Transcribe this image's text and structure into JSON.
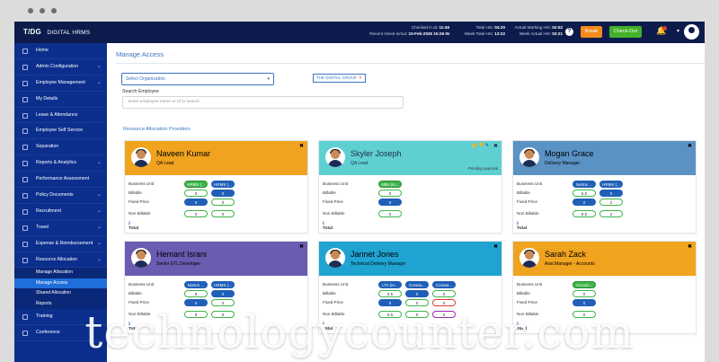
{
  "header": {
    "logo_mark": "T/DG",
    "logo_sub": "DIGITAL HRMS",
    "checked_in_label": "Checked in at:",
    "checked_in_value": "11:46",
    "recent_checkin_label": "Recent check-in/out:",
    "recent_checkin_value": "10-Feb-2025 15:26 IN",
    "total_hrs_label": "Total Hrs:",
    "total_hrs_value": "04:20",
    "week_total_label": "Week Total Hrs:",
    "week_total_value": "13:22",
    "actual_working_label": "Actual Working Hrs:",
    "actual_working_value": "02:52",
    "week_actual_label": "Week Actual Hrs:",
    "week_actual_value": "03:21",
    "help_icon": "?",
    "break_label": "Break",
    "checkout_label": "Check-Out",
    "bell_icon": "bell-icon"
  },
  "sidebar": {
    "items": [
      {
        "label": "Home",
        "caret": ""
      },
      {
        "label": "Admin Configuration",
        "caret": "⌄"
      },
      {
        "label": "Employee Management",
        "caret": "⌄"
      },
      {
        "label": "My Details",
        "caret": ""
      },
      {
        "label": "Leave & Attendance",
        "caret": ""
      },
      {
        "label": "Employee Self Service",
        "caret": ""
      },
      {
        "label": "Separation",
        "caret": ""
      },
      {
        "label": "Reports & Analytics",
        "caret": "⌄"
      },
      {
        "label": "Performance Assessment",
        "caret": ""
      },
      {
        "label": "Policy Documents",
        "caret": "⌄"
      },
      {
        "label": "Recruitment",
        "caret": "⌄"
      },
      {
        "label": "Travel",
        "caret": "⌄"
      },
      {
        "label": "Expense & Reimbursement",
        "caret": "⌄"
      },
      {
        "label": "Resource Allocation",
        "caret": "⌄"
      }
    ],
    "subitems": [
      "Manage Allocation",
      "Manage Access",
      "Shared Allocation",
      "Reports"
    ],
    "after_items": [
      {
        "label": "Training",
        "caret": ""
      },
      {
        "label": "Conference",
        "caret": ""
      }
    ]
  },
  "main": {
    "title": "Manage Access",
    "select_org": "Select Organization",
    "org_tag": "THE DIGITAL GROUP",
    "search_label": "Search Employee",
    "search_placeholder": "Enter employee name or Id to search",
    "section_title": "Resource Allocation Providers"
  },
  "row_labels": {
    "bu": "Business Unit",
    "billable": "Billable",
    "fixed": "Fixed Price",
    "nonbill": "Non Billable",
    "total": "Total",
    "info": "ℹ"
  },
  "cards": [
    {
      "name": "Naveen Kumar",
      "role": "QA Lead",
      "color": "#f0a31e",
      "bu": [
        "HRMS (...",
        "HRMS (..."
      ],
      "billable": [
        "0",
        "0"
      ],
      "fixed": [
        "0",
        "0"
      ],
      "nonbill": [
        "0",
        "0"
      ]
    },
    {
      "name": "Skyler Joseph",
      "role": "QA Lead",
      "color": "#5fd0d2",
      "pending": "Pending Approval",
      "bu": [
        "NBA (In..."
      ],
      "billable": [
        "0"
      ],
      "fixed": [
        "0"
      ],
      "nonbill": [
        "0"
      ]
    },
    {
      "name": "Mogan Grace",
      "role": "Delivery Manager",
      "color": "#5a92c4",
      "bu": [
        "Norton ...",
        "HRMS (..."
      ],
      "billable": [
        "6.5",
        "0"
      ],
      "fixed": [
        "2",
        "2"
      ],
      "nonbill": [
        "8.5",
        "2"
      ]
    },
    {
      "name": "Hemant Israni",
      "role": "Senior ETL Developer",
      "color": "#6b5bb1",
      "bu": [
        "Norton ...",
        "HRMS (..."
      ],
      "billable": [
        "9",
        "0"
      ],
      "fixed": [
        "0",
        "0"
      ],
      "nonbill": [
        "9",
        "0"
      ]
    },
    {
      "name": "Jannet Jones",
      "role": "Technical Delivery Manager",
      "color": "#1fa4d2",
      "bu": [
        "LTA (In...",
        "Corsea...",
        "Corsea..."
      ],
      "billable": [
        "0.5",
        "0",
        "0"
      ],
      "fixed": [
        "0",
        "0",
        "0"
      ],
      "nonbill": [
        "8.5",
        "0",
        "0"
      ]
    },
    {
      "name": "Sarah Zack",
      "role": "Asst.Manager - Accounts",
      "color": "#f0a31e",
      "bu": [
        "Accoun..."
      ],
      "billable": [
        "0"
      ],
      "fixed": [
        "0"
      ],
      "nonbill": [
        "0"
      ]
    }
  ],
  "watermark": "technologycounter.com"
}
